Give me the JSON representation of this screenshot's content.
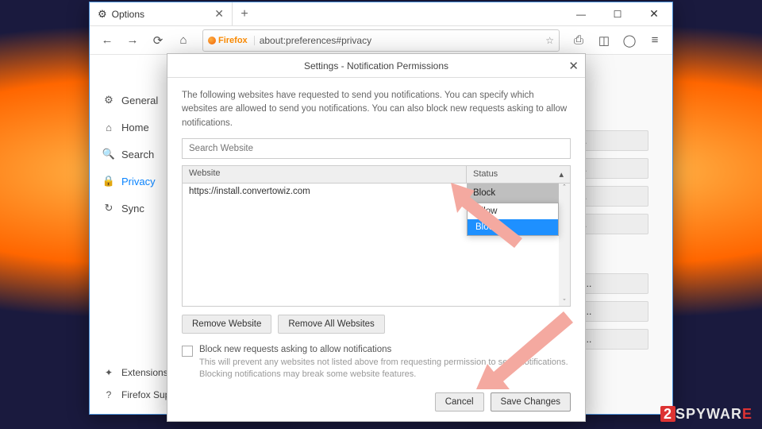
{
  "window": {
    "tab_title": "Options",
    "new_tab": "+",
    "min": "—",
    "max": "☐",
    "close": "✕"
  },
  "nav": {
    "back": "←",
    "fwd": "→",
    "reload": "⟳",
    "home": "⌂",
    "ff_label": "Firefox",
    "url": "about:preferences#privacy",
    "star": "☆",
    "library": "⎙",
    "sidebar": "◫",
    "account": "◯",
    "menu": "≡"
  },
  "sidebar": {
    "general": "General",
    "home": "Home",
    "search": "Search",
    "privacy": "Privacy",
    "sync": "Sync",
    "extensions": "Extensions",
    "support": "Firefox Support"
  },
  "side_settings_label": "ngs...",
  "side_settings_label2": "tions...",
  "dialog": {
    "title": "Settings - Notification Permissions",
    "close": "✕",
    "desc": "The following websites have requested to send you notifications. You can specify which websites are allowed to send you notifications. You can also block new requests asking to allow notifications.",
    "search_placeholder": "Search Website",
    "col_website": "Website",
    "col_status": "Status",
    "row_url": "https://install.convertowiz.com",
    "row_status": "Block",
    "dd_allow": "Allow",
    "dd_block": "Block",
    "remove_one": "Remove Website",
    "remove_all": "Remove All Websites",
    "chk_label": "Block new requests asking to allow notifications",
    "chk_sub": "This will prevent any websites not listed above from requesting permission to send notifications. Blocking notifications may break some website features.",
    "cancel": "Cancel",
    "save": "Save Changes"
  },
  "watermark": {
    "two": "2",
    "spy": "SPYWAR",
    "e": "E"
  }
}
